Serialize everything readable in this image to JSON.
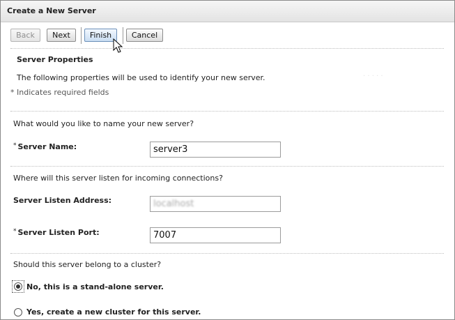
{
  "window": {
    "title": "Create a New Server"
  },
  "toolbar": {
    "back_label": "Back",
    "next_label": "Next",
    "finish_label": "Finish",
    "cancel_label": "Cancel"
  },
  "section": {
    "heading": "Server Properties",
    "description": "The following properties will be used to identify your new server.",
    "required_note": "* Indicates required fields"
  },
  "name_block": {
    "question": "What would you like to name your new server?",
    "label": "Server Name:",
    "value": "server3"
  },
  "listen_block": {
    "question": "Where will this server listen for incoming connections?",
    "address_label": "Server Listen Address:",
    "address_value": "localhost",
    "port_label": "Server Listen Port:",
    "port_value": "7007"
  },
  "cluster_block": {
    "question": "Should this server belong to a cluster?",
    "options": [
      {
        "label": "No, this is a stand-alone server.",
        "selected": true
      },
      {
        "label": "Yes, create a new cluster for this server.",
        "selected": false
      }
    ]
  },
  "required_marker": "*",
  "icons": {
    "cursor": "mouse-pointer-icon"
  }
}
